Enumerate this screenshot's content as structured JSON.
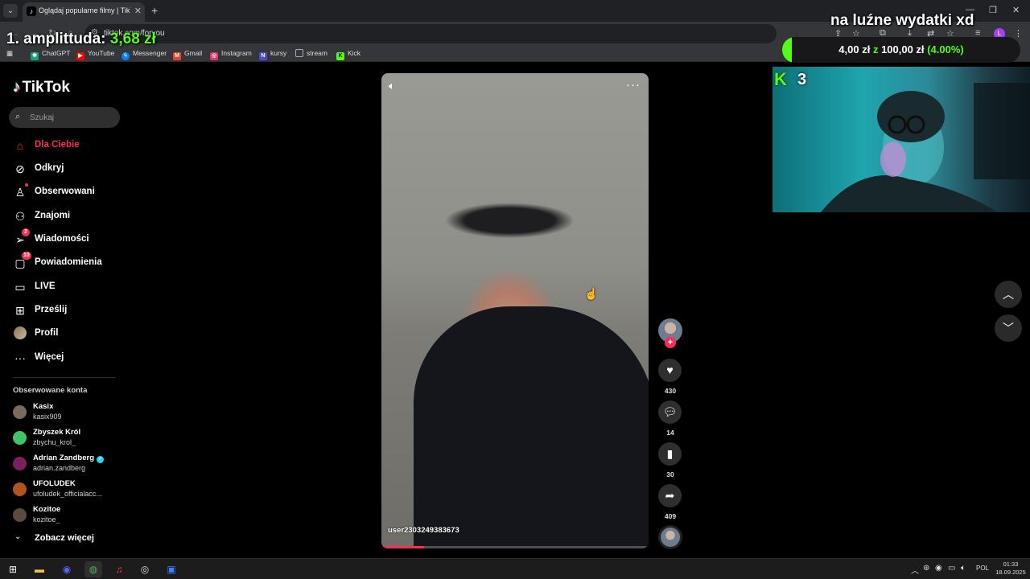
{
  "browser": {
    "tab_title": "Oglądaj popularne filmy | TikTok",
    "url": "tiktok.com/foryou",
    "bookmarks": [
      {
        "label": "ChatGPT",
        "color": "#10a37f"
      },
      {
        "label": "YouTube",
        "color": "#ff0000"
      },
      {
        "label": "Messenger",
        "color": "#0084ff"
      },
      {
        "label": "Gmail",
        "color": "#ea4335"
      },
      {
        "label": "Instagram",
        "color": "#e1306c"
      },
      {
        "label": "kursy",
        "color": "#4b4bd6"
      },
      {
        "label": "stream",
        "color": "#888888"
      },
      {
        "label": "Kick",
        "color": "#53fc18"
      }
    ]
  },
  "overlay": {
    "amount_label": "1. amplittuda:",
    "amount_value": "3,68 zł",
    "goal_title": "na luźne wydatki xd",
    "goal_current": "4,00 zł",
    "goal_of": "z",
    "goal_target": "100,00 zł",
    "goal_percent": "(4.00%)",
    "goal_fraction": 0.04,
    "kick_viewers": "3"
  },
  "tiktok": {
    "logo": "TikTok",
    "search_placeholder": "Szukaj",
    "nav": [
      {
        "label": "Dla Ciebie",
        "icon": "home-icon",
        "active": true
      },
      {
        "label": "Odkryj",
        "icon": "compass-icon"
      },
      {
        "label": "Obserwowani",
        "icon": "following-icon"
      },
      {
        "label": "Znajomi",
        "icon": "friends-icon"
      },
      {
        "label": "Wiadomości",
        "icon": "messages-icon",
        "badge": "2"
      },
      {
        "label": "Powiadomienia",
        "icon": "notifications-icon",
        "badge": "10"
      },
      {
        "label": "LIVE",
        "icon": "live-icon"
      },
      {
        "label": "Prześlij",
        "icon": "upload-icon"
      },
      {
        "label": "Profil",
        "icon": "profile-icon"
      },
      {
        "label": "Więcej",
        "icon": "more-icon"
      }
    ],
    "followed_title": "Obserwowane konta",
    "followed": [
      {
        "name": "Kasix",
        "user": "kasix909",
        "color": "#7a6a5c"
      },
      {
        "name": "Zbyszek Król",
        "user": "zbychu_krol_",
        "color": "#3fc46b"
      },
      {
        "name": "Adrian Zandberg",
        "user": "adrian.zandberg",
        "color": "#7b1f5e",
        "verified": true
      },
      {
        "name": "UFOLUDEK",
        "user": "ufoludek_officialacc...",
        "color": "#b3541e"
      },
      {
        "name": "Kozitoe",
        "user": "kozitoe_",
        "color": "#5a4a3f"
      }
    ],
    "see_more": "Zobacz więcej",
    "video": {
      "author": "user2303249383673",
      "progress_fraction": 0.16
    },
    "actions": {
      "likes": "430",
      "comments": "14",
      "saves": "30",
      "shares": "409"
    }
  },
  "taskbar": {
    "lang": "POL",
    "time": "01:33",
    "date": "18.09.2025"
  }
}
